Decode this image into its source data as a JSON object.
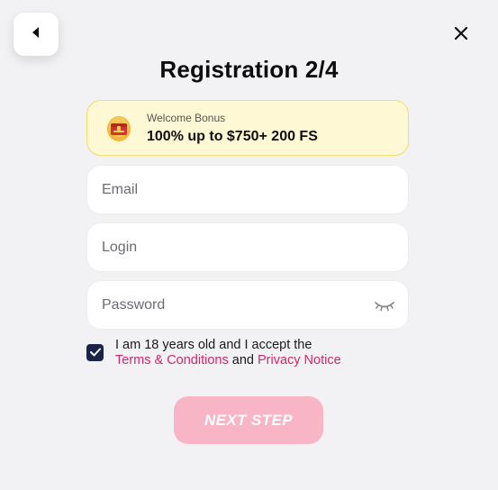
{
  "header": {
    "title": "Registration 2/4",
    "back_icon": "caret-left-icon",
    "close_icon": "close-icon"
  },
  "bonus": {
    "label": "Welcome Bonus",
    "value": "100% up to $750+ 200 FS",
    "icon": "treasure-chest-icon"
  },
  "form": {
    "email": {
      "placeholder": "Email",
      "value": ""
    },
    "login": {
      "placeholder": "Login",
      "value": ""
    },
    "password": {
      "placeholder": "Password",
      "value": "",
      "toggle_icon": "eye-closed-icon"
    }
  },
  "consent": {
    "checked": true,
    "text_prefix": "I am 18 years old and I accept the",
    "terms_link": "Terms & Conditions",
    "and_text": "and",
    "privacy_link": "Privacy Notice"
  },
  "actions": {
    "next_label": "NEXT STEP"
  },
  "colors": {
    "accent": "#d6256a",
    "button": "#f7b5c6",
    "checkbox": "#1b2446",
    "bonus_bg": "#fff8d4"
  }
}
